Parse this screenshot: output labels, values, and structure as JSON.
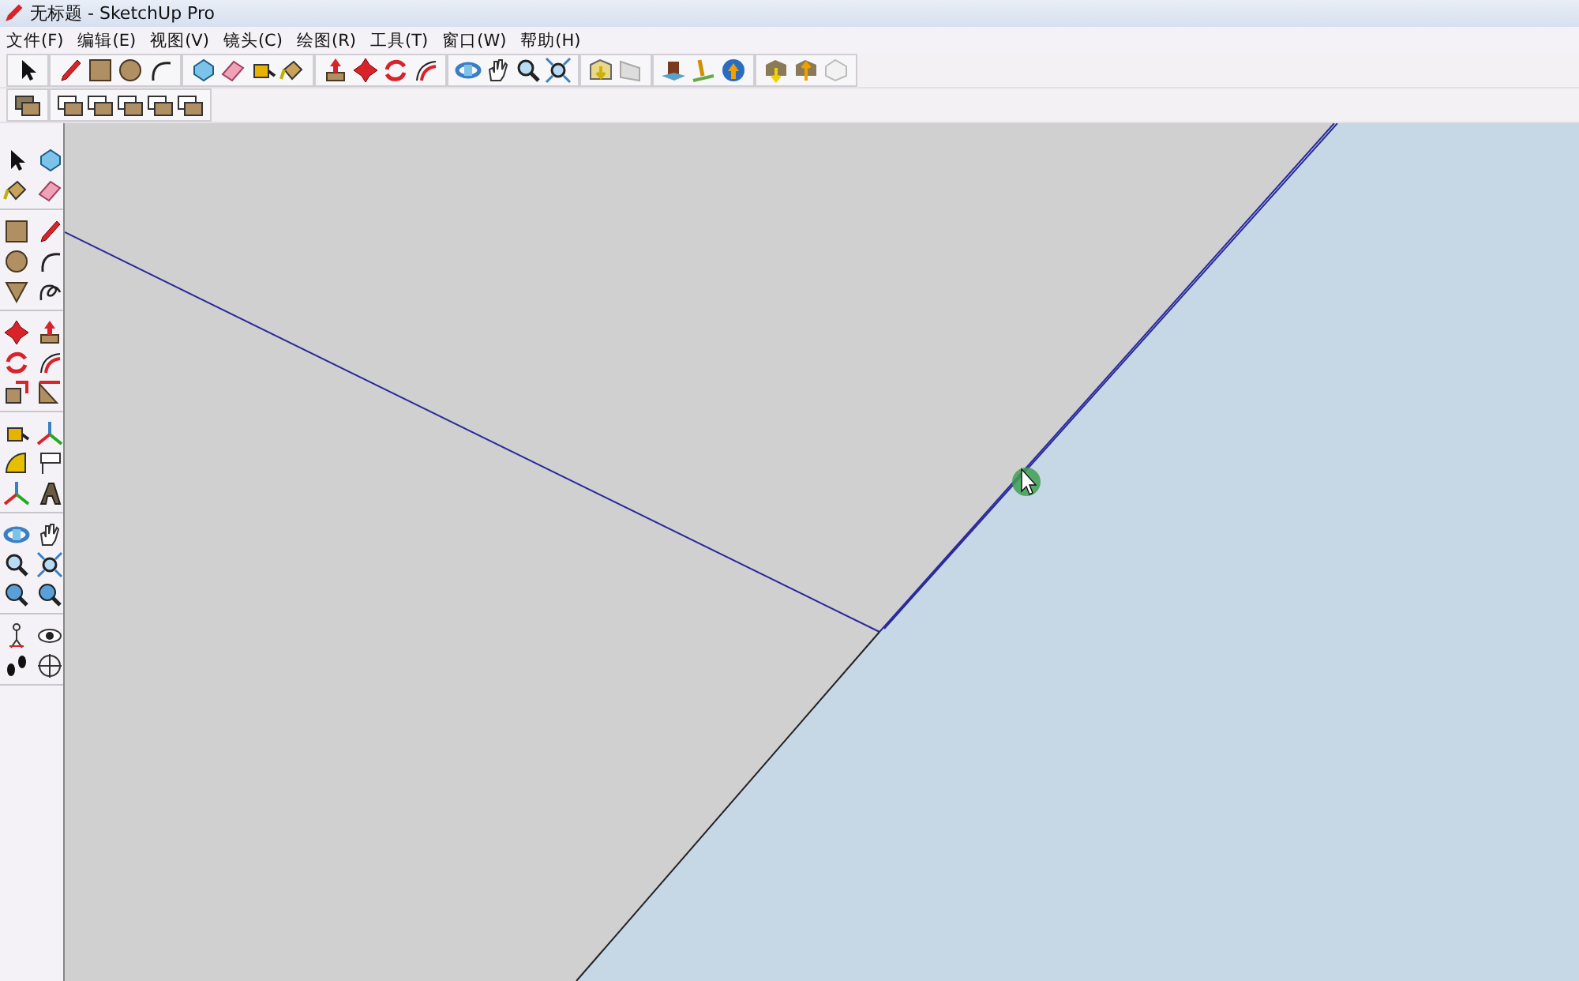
{
  "window": {
    "title": "无标题 - SketchUp Pro"
  },
  "menu": [
    {
      "label": "文件(F)"
    },
    {
      "label": "编辑(E)"
    },
    {
      "label": "视图(V)"
    },
    {
      "label": "镜头(C)"
    },
    {
      "label": "绘图(R)"
    },
    {
      "label": "工具(T)"
    },
    {
      "label": "窗口(W)"
    },
    {
      "label": "帮助(H)"
    }
  ]
}
